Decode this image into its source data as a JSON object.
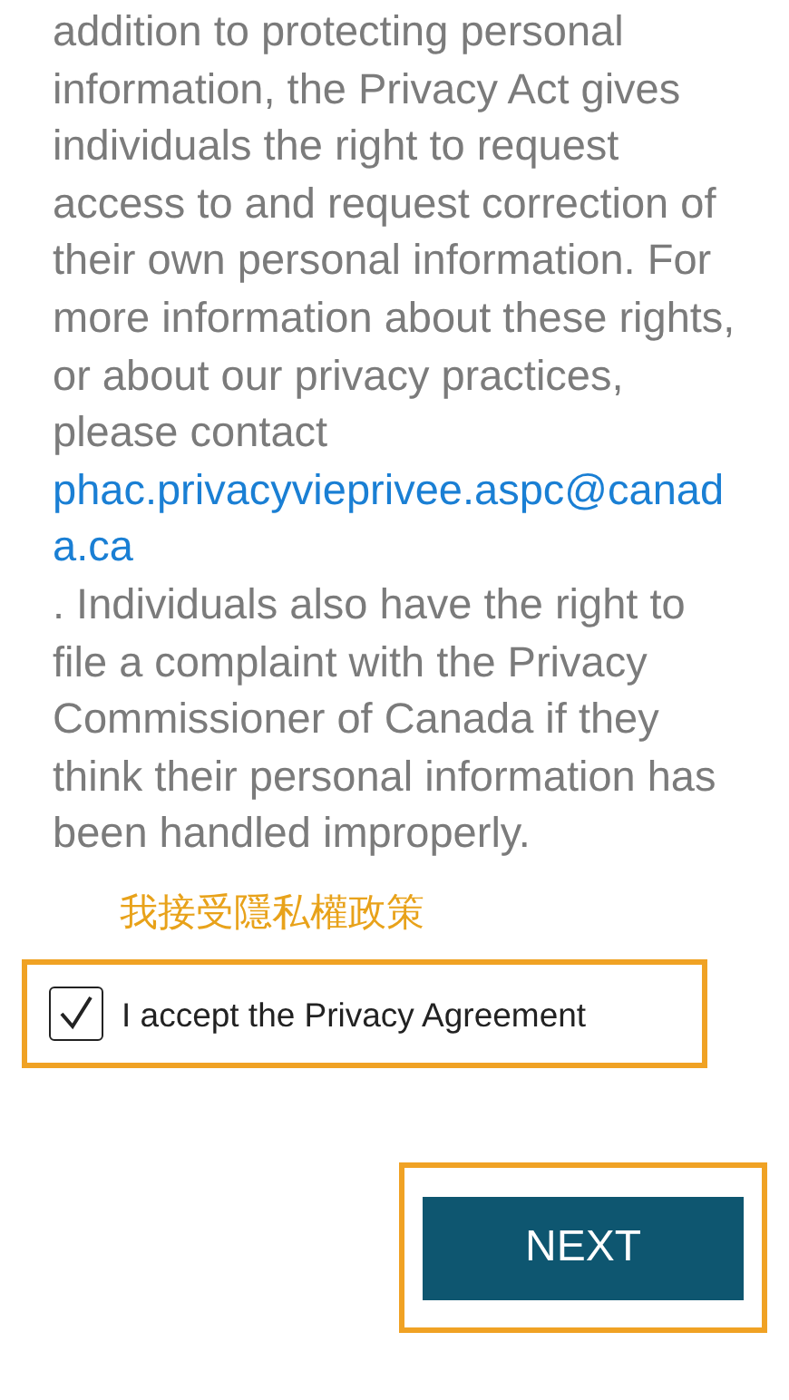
{
  "body": {
    "text_before": "addition to protecting personal information, the Privacy Act gives individuals the right to request access to and request correction of their own personal information. For more information about these rights, or about our privacy practices, please contact ",
    "link": "phac.privacyvieprivee.aspc@canada.ca",
    "text_after": ". Individuals also have the right to file a complaint with the Privacy Commissioner of Canada if they think their personal information has been handled improperly."
  },
  "annotation": {
    "text": "我接受隱私權政策"
  },
  "consent": {
    "label": "I accept the Privacy Agreement",
    "checked": true,
    "highlighted": true
  },
  "next_button": {
    "label": "NEXT",
    "highlighted": true
  }
}
